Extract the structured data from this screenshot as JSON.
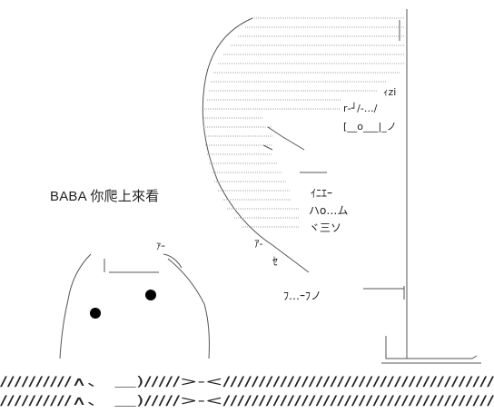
{
  "caption": "BABA 你爬上來看",
  "character_marks": {
    "ita": "ｨzi",
    "hat": "r‐┘/‐…/",
    "eye_line": "[__o___|_ノ",
    "mouth_a": "ｲﾆｴｰ",
    "mouth_b": "ハo…ム",
    "mouth_c": "ヾ三ソ",
    "shout_small": "ｱｰ",
    "creature_text": "ﾌ…ｰﾌノ",
    "seven": "ｾ",
    "te": "ｱ-",
    "lambda": "∧"
  },
  "ground_text": "//////////∧、 ＿)/////>-<//////////////////////////////////////"
}
